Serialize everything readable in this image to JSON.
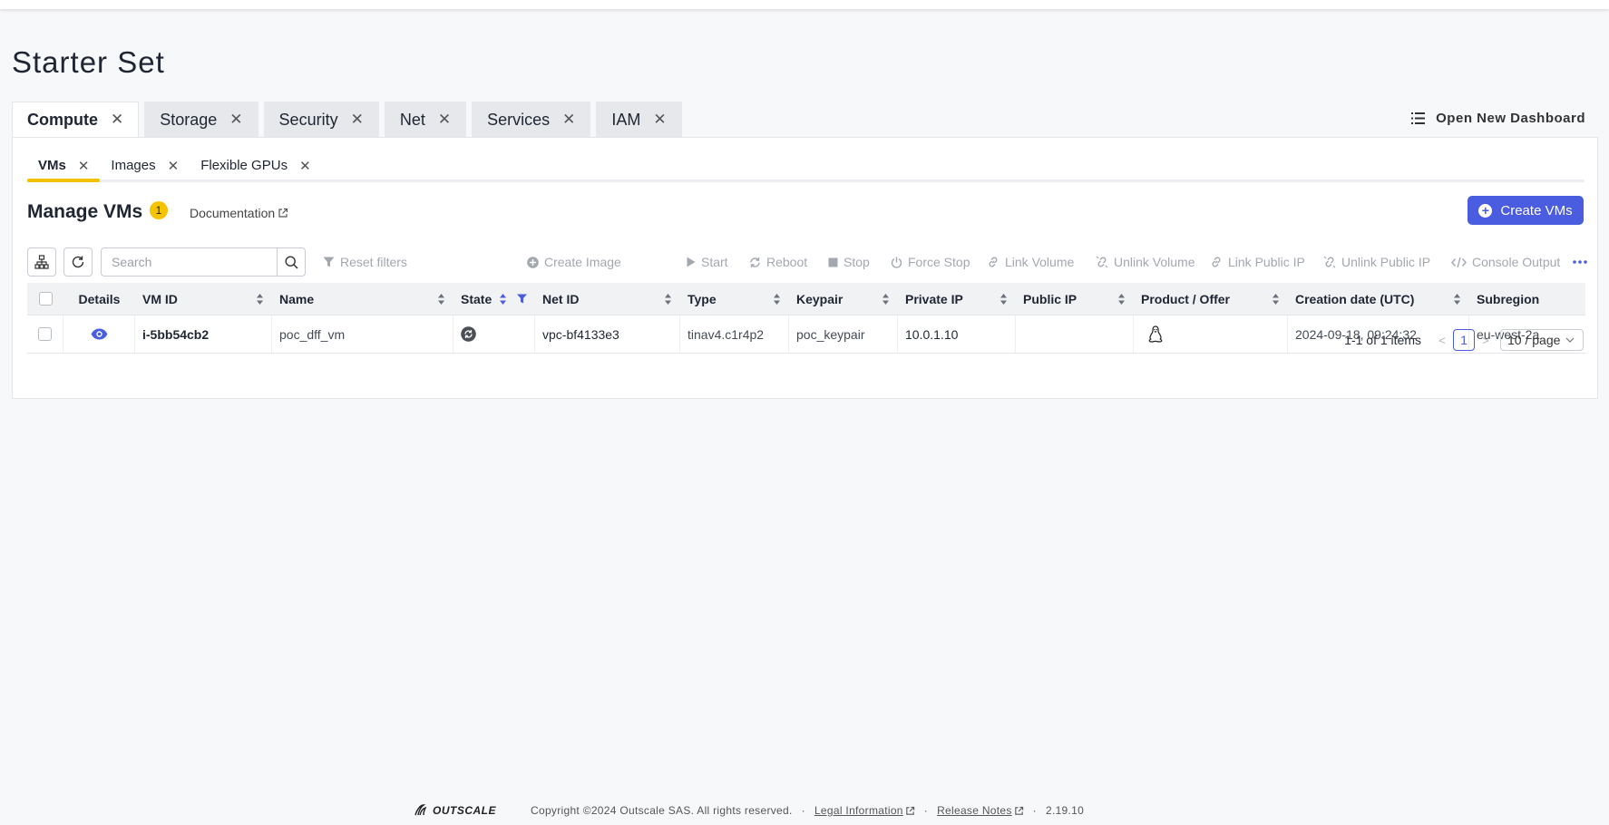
{
  "page": {
    "title": "Starter Set"
  },
  "tabs": [
    {
      "label": "Compute",
      "active": true
    },
    {
      "label": "Storage"
    },
    {
      "label": "Security"
    },
    {
      "label": "Net"
    },
    {
      "label": "Services"
    },
    {
      "label": "IAM"
    }
  ],
  "open_dashboard_label": "Open New Dashboard",
  "subtabs": [
    {
      "label": "VMs",
      "active": true
    },
    {
      "label": "Images"
    },
    {
      "label": "Flexible GPUs"
    }
  ],
  "manage": {
    "title": "Manage VMs",
    "badge": "1",
    "documentation": "Documentation",
    "create_button": "Create VMs"
  },
  "toolbar": {
    "search_placeholder": "Search",
    "reset_filters": "Reset filters",
    "actions": {
      "create_image": "Create Image",
      "start": "Start",
      "reboot": "Reboot",
      "stop": "Stop",
      "force_stop": "Force Stop",
      "link_volume": "Link Volume",
      "unlink_volume": "Unlink Volume",
      "link_public_ip": "Link Public IP",
      "unlink_public_ip": "Unlink Public IP",
      "console_output": "Console Output"
    }
  },
  "table": {
    "columns": {
      "details": "Details",
      "vm_id": "VM ID",
      "name": "Name",
      "state": "State",
      "net_id": "Net ID",
      "type": "Type",
      "keypair": "Keypair",
      "private_ip": "Private IP",
      "public_ip": "Public IP",
      "product_offer": "Product / Offer",
      "creation_date": "Creation date (UTC)",
      "subregion": "Subregion"
    },
    "rows": [
      {
        "vm_id": "i-5bb54cb2",
        "name": "poc_dff_vm",
        "state_icon": "pending-state-icon",
        "net_id": "vpc-bf4133e3",
        "type": "tinav4.c1r4p2",
        "keypair": "poc_keypair",
        "private_ip": "10.0.1.10",
        "public_ip": "",
        "product_icon": "linux-icon",
        "creation_date": "2024-09-18, 09:24:32",
        "subregion": "eu-west-2a"
      }
    ]
  },
  "pagination": {
    "total": "1-1 of 1 items",
    "current": "1",
    "page_size": "10 / page"
  },
  "footer": {
    "logo": "OUTSCALE",
    "copyright": "Copyright ©2024 Outscale SAS. All rights reserved.",
    "legal": "Legal Information",
    "release": "Release Notes",
    "version": "2.19.10"
  },
  "colors": {
    "accent": "#4a5cdf",
    "tab_highlight": "#f2c200",
    "badge": "#f5c400"
  }
}
